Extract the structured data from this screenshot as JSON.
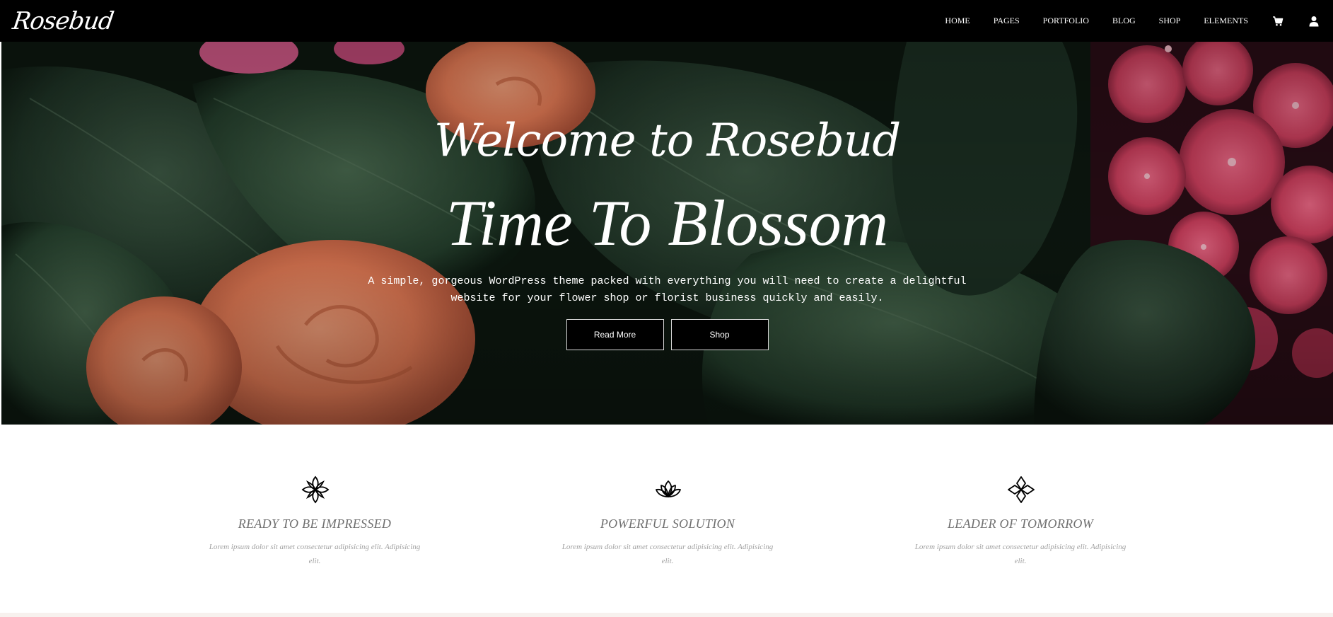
{
  "header": {
    "logo": "Rosebud",
    "nav": [
      {
        "label": "HOME"
      },
      {
        "label": "PAGES"
      },
      {
        "label": "PORTFOLIO"
      },
      {
        "label": "BLOG"
      },
      {
        "label": "SHOP"
      },
      {
        "label": "ELEMENTS"
      }
    ],
    "icons": [
      "cart-icon",
      "user-icon"
    ]
  },
  "hero": {
    "welcome": "Welcome to Rosebud",
    "title": "Time To Blossom",
    "text": "A simple, gorgeous WordPress theme packed with everything you will need to create a delightful website for your flower shop or florist business quickly and easily.",
    "buttons": {
      "read_more": "Read More",
      "shop": "Shop"
    }
  },
  "features": [
    {
      "icon": "four-petal-flower-icon",
      "title": "READY TO BE IMPRESSED",
      "text": "Lorem ipsum dolor sit amet consectetur adipisicing elit. Adipisicing elit."
    },
    {
      "icon": "lotus-icon",
      "title": "POWERFUL SOLUTION",
      "text": "Lorem ipsum dolor sit amet consectetur adipisicing elit. Adipisicing elit."
    },
    {
      "icon": "diamond-flower-icon",
      "title": "LEADER OF TOMORROW",
      "text": "Lorem ipsum dolor sit amet consectetur adipisicing elit. Adipisicing elit."
    }
  ],
  "colors": {
    "header_bg": "#000000",
    "leaf_dark": "#1f3426",
    "rose_orange": "#f08a62",
    "hydrangea_pink": "#d94b6d",
    "feature_title": "#6f6f6f",
    "feature_text": "#a1a1a1"
  }
}
